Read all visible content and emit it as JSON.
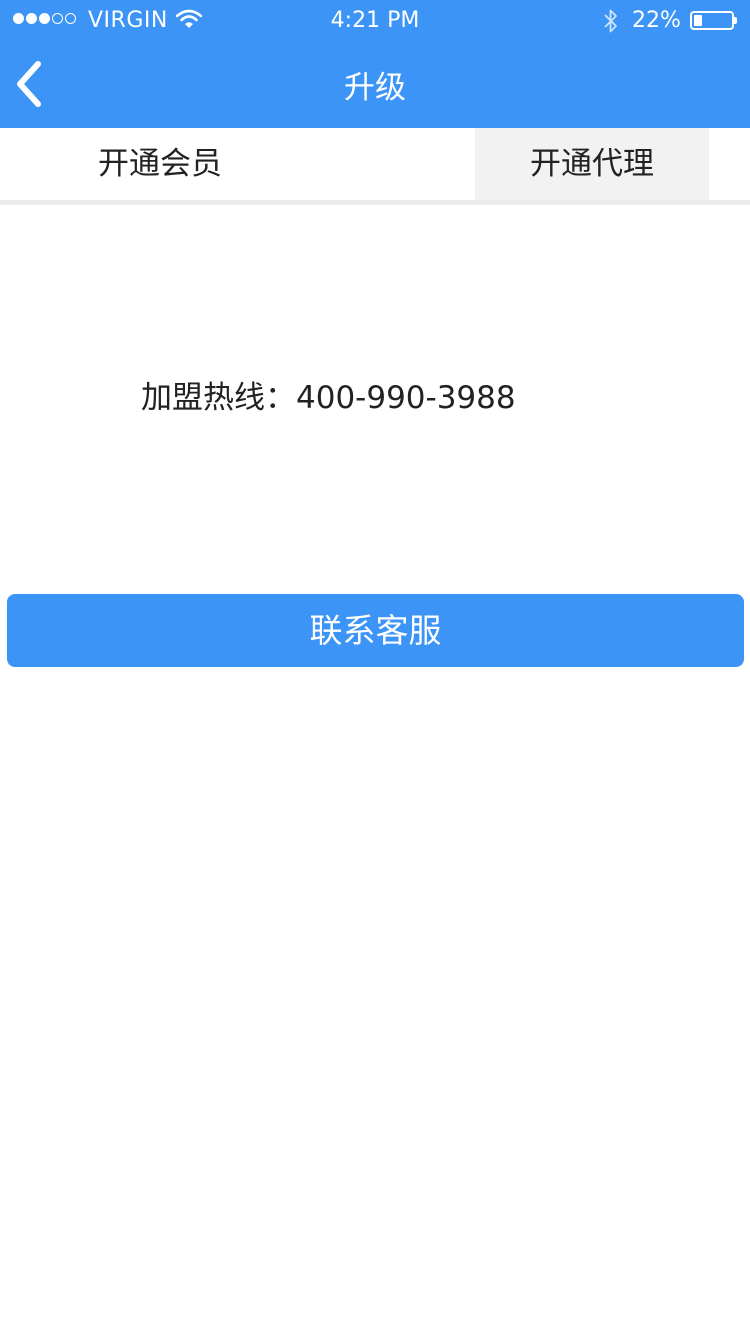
{
  "status_bar": {
    "carrier": "VIRGIN",
    "time": "4:21 PM",
    "battery_percent_text": "22%",
    "battery_level": 0.22,
    "signal_bars_filled": 3,
    "signal_bars_total": 5,
    "icons": [
      "wifi-icon",
      "bluetooth-icon",
      "battery-icon"
    ]
  },
  "nav": {
    "title": "升级",
    "back_icon": "chevron-left-icon"
  },
  "tabs": [
    {
      "label": "开通会员",
      "selected": false
    },
    {
      "label": "开通代理",
      "selected": true
    }
  ],
  "hotline": {
    "label": "加盟热线：400-990-3988"
  },
  "contact_button": {
    "label": "联系客服"
  },
  "colors": {
    "primary": "#3c94f6",
    "selected_tab_bg": "#f2f2f2",
    "text": "#222222"
  }
}
